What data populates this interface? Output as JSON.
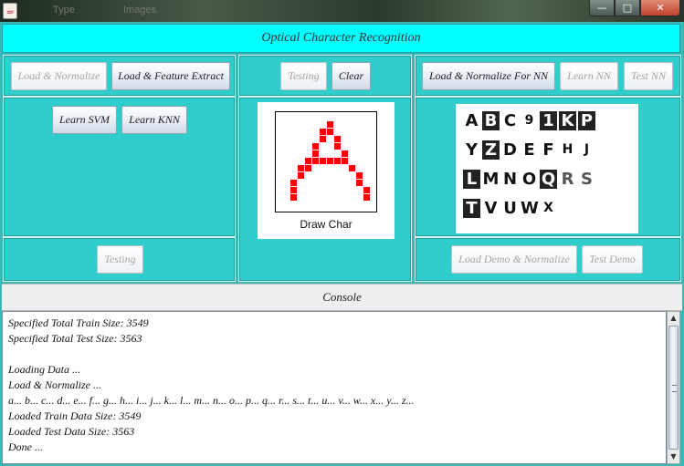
{
  "window": {
    "background_text": [
      "Type",
      "Images"
    ],
    "controls": {
      "minimize": "—",
      "maximize": "□",
      "close": "✕"
    }
  },
  "header": {
    "title": "Optical Character Recognition"
  },
  "left_panel": {
    "load_normalize": "Load & Normalize",
    "load_feature_extract": "Load & Feature Extract",
    "learn_svm": "Learn SVM",
    "learn_knn": "Learn KNN",
    "testing": "Testing"
  },
  "center_panel": {
    "testing": "Testing",
    "clear": "Clear",
    "draw_label": "Draw Char",
    "drawn_char_color": "#ff0000"
  },
  "right_panel": {
    "load_normalize_nn": "Load & Normalize For NN",
    "learn_nn": "Learn NN",
    "test_nn": "Test NN",
    "load_demo_normalize": "Load Demo & Normalize",
    "test_demo": "Test Demo",
    "sample_rows": [
      [
        "A",
        "B",
        "C",
        "9",
        "1",
        "K",
        "P"
      ],
      [
        "Y",
        "Z",
        "D",
        "E",
        "F",
        "H",
        "J"
      ],
      [
        "L",
        "M",
        "N",
        "O",
        "Q",
        "R",
        "S"
      ],
      [
        "T",
        "V",
        "U",
        "W",
        "X"
      ]
    ]
  },
  "console": {
    "title": "Console",
    "lines": [
      "Specified Total Train Size: 3549",
      "Specified Total Test Size: 3563",
      "",
      "Loading Data ...",
      "Load & Normalize ...",
      "a... b... c... d... e... f... g... h... i... j... k... l... m... n... o... p... q... r... s... t... u... v... w... x... y... z...",
      "Loaded Train Data Size: 3549",
      "Loaded Test Data Size: 3563",
      "Done ..."
    ]
  },
  "colors": {
    "header_bg": "#00ffff",
    "panel_bg": "#2fcdcc",
    "frame_bg": "#39b8b8"
  }
}
